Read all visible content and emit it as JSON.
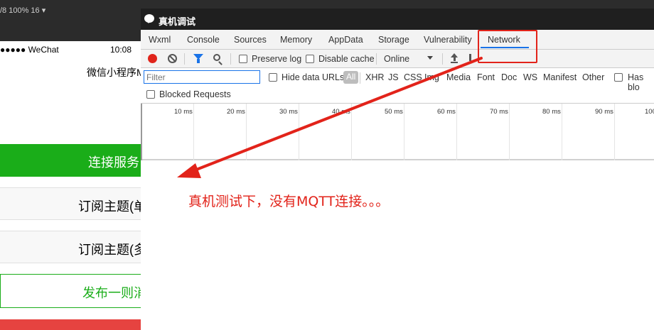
{
  "ide": {
    "status_text": "/8 100% 16 ▾"
  },
  "phone": {
    "carrier": "●●●●● WeChat",
    "time": "10:08",
    "title": "微信小程序M",
    "buttons": {
      "connect": "连接服务",
      "subscribe_single": "订阅主题(单",
      "subscribe_multi": "订阅主题(多",
      "publish": "发布一则消"
    },
    "colors": {
      "green": "#1aad19",
      "red": "#e64340"
    }
  },
  "devtools": {
    "title": "真机调试",
    "tabs": [
      "Wxml",
      "Console",
      "Sources",
      "Memory",
      "AppData",
      "Storage",
      "Vulnerability",
      "Network"
    ],
    "active_tab": "Network",
    "toolbar": {
      "preserve_log": "Preserve log",
      "disable_cache": "Disable cache",
      "throttling": "Online"
    },
    "filter": {
      "placeholder": "Filter",
      "hide_data_urls": "Hide data URLs",
      "all": "All",
      "types": [
        "XHR",
        "JS",
        "CSS",
        "Img",
        "Media",
        "Font",
        "Doc",
        "WS",
        "Manifest",
        "Other"
      ],
      "has_blocked": "Has blo",
      "blocked_requests": "Blocked Requests"
    },
    "timeline_ticks": [
      "10 ms",
      "20 ms",
      "30 ms",
      "40 ms",
      "50 ms",
      "60 ms",
      "70 ms",
      "80 ms",
      "90 ms",
      "100"
    ]
  },
  "annotation": {
    "text": "真机测试下，没有MQTT连接。。。",
    "color": "#e2231a"
  }
}
